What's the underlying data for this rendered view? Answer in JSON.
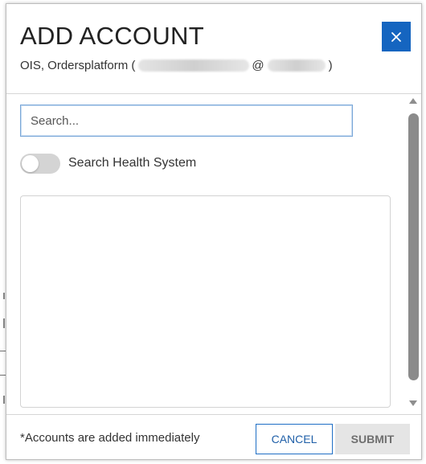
{
  "dialog": {
    "title": "ADD ACCOUNT",
    "subtitle_prefix": "OIS, Ordersplatform (",
    "subtitle_at": "@",
    "subtitle_suffix": ")",
    "close_icon": "close-icon"
  },
  "search": {
    "placeholder": "Search...",
    "value": ""
  },
  "toggle": {
    "label": "Search Health System",
    "on": false
  },
  "footer": {
    "note": "*Accounts are added immediately",
    "cancel_label": "CANCEL",
    "submit_label": "SUBMIT"
  },
  "colors": {
    "accent": "#1565c0",
    "button_disabled_bg": "#e5e5e5",
    "toggle_off": "#d4d4d4"
  }
}
